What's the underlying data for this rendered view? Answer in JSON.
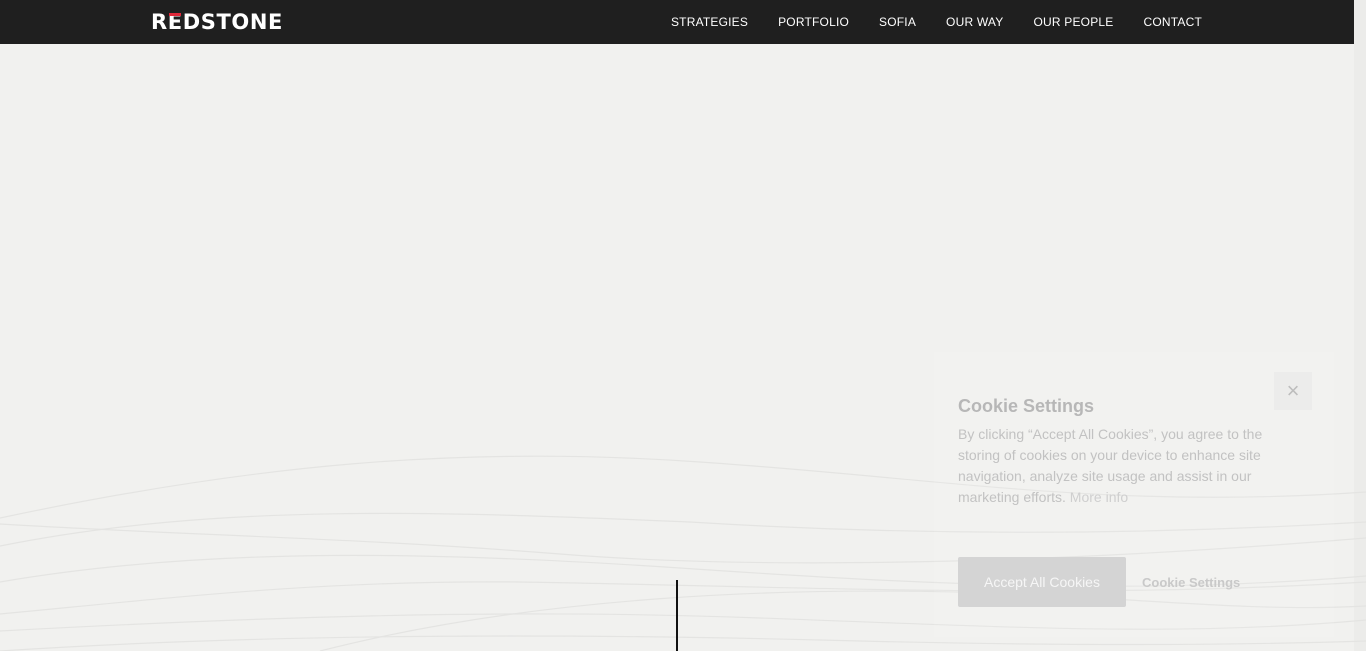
{
  "header": {
    "brand": {
      "prefix": "R",
      "mark": "E",
      "suffix": "DSTONE"
    },
    "nav": [
      "STRATEGIES",
      "PORTFOLIO",
      "SOFIA",
      "OUR WAY",
      "OUR PEOPLE",
      "CONTACT"
    ]
  },
  "cookie_settings": {
    "title": "Cookie Settings",
    "description": "By clicking “Accept All Cookies”, you agree to the storing of cookies on your device to enhance site navigation, analyze site usage and assist in our marketing efforts.",
    "more_info": "More info",
    "accept_button": "Accept All Cookies",
    "settings_button": "Cookie Settings",
    "close_icon": "close-icon"
  },
  "colors": {
    "header_background": "#1f1f1f",
    "brand_accent": "#e0283a",
    "page_background": "#f1f1ef"
  }
}
